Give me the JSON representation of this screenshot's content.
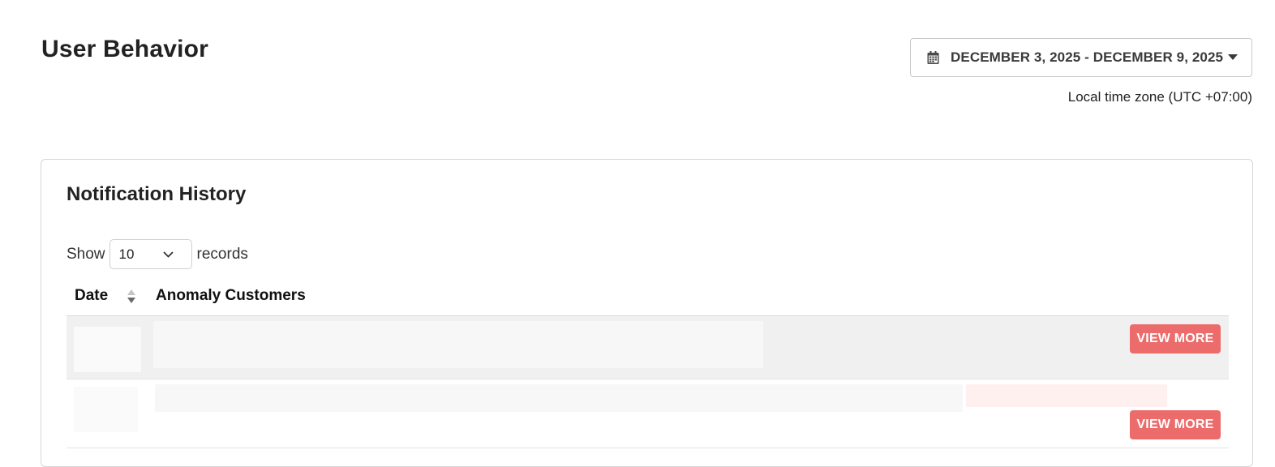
{
  "header": {
    "title": "User Behavior",
    "date_range_label": "DECEMBER 3, 2025 - DECEMBER 9, 2025",
    "timezone_text": "Local time zone (UTC +07:00)"
  },
  "notifications": {
    "title": "Notification History",
    "show_prefix": "Show",
    "page_size": "10",
    "show_suffix": "records",
    "columns": [
      "Date",
      "Anomaly Customers"
    ],
    "rows": [
      {
        "action_label": "VIEW MORE"
      },
      {
        "action_label": "VIEW MORE"
      }
    ]
  },
  "icons": {
    "date_range": "calendar-icon",
    "dropdown": "caret-down-icon",
    "page_size": "chevron-down-icon",
    "sort": "sort-icon"
  },
  "colors": {
    "accent_button": "#ec6b6b",
    "striped_row": "#f0f0f0"
  }
}
